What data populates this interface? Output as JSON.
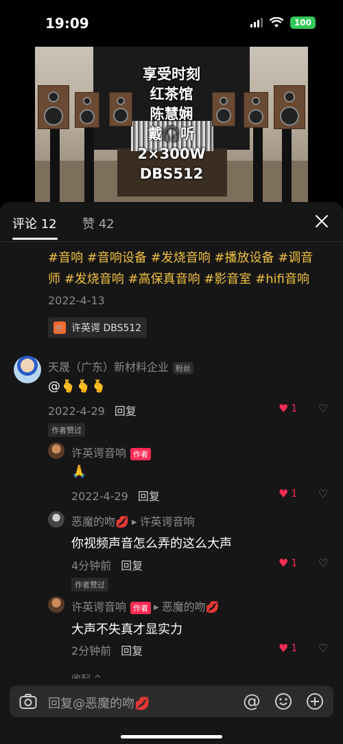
{
  "status_bar": {
    "time": "19:09",
    "battery": "100"
  },
  "video": {
    "overlay_lines": [
      "享受时刻",
      "红茶馆",
      "陈慧娴",
      "戴🎧听",
      "2×300W",
      "DBS512"
    ]
  },
  "tabs": {
    "comments_label": "评论",
    "comments_count": "12",
    "likes_label": "赞",
    "likes_count": "42"
  },
  "post": {
    "hashtags": "#音响 #音响设备 #发烧音响 #播放设备 #调音师 #发烧音响 #高保真音响 #影音室 #hifi音响",
    "date": "2022-4-13",
    "product": "许英谔 DBS512"
  },
  "comments": [
    {
      "user": "天晟（广东）新材料企业",
      "tag": "粉丝",
      "text": "@🫰🫰🫰",
      "date": "2022-4-29",
      "reply": "回复",
      "likes": "1",
      "author_liked": "作者赞过"
    },
    {
      "user": "许英谔音响",
      "tag": "作者",
      "text": "🙏",
      "date": "2022-4-29",
      "reply": "回复",
      "likes": "1"
    },
    {
      "user": "恶魔的吻💋",
      "reply_to": "许英谔音响",
      "text": "你视频声音怎么弄的这么大声",
      "date": "4分钟前",
      "reply": "回复",
      "likes": "1",
      "author_liked": "作者赞过"
    },
    {
      "user": "许英谔音响",
      "tag": "作者",
      "reply_to": "恶魔的吻💋",
      "text": "大声不失真才显实力",
      "date": "2分钟前",
      "reply": "回复",
      "likes": "1"
    }
  ],
  "collapse_label": "收起 ^",
  "input": {
    "placeholder": "回复@恶魔的吻💋"
  },
  "colors": {
    "accent": "#fe2c55",
    "hashtag": "#f0c040",
    "battery": "#34c759"
  }
}
